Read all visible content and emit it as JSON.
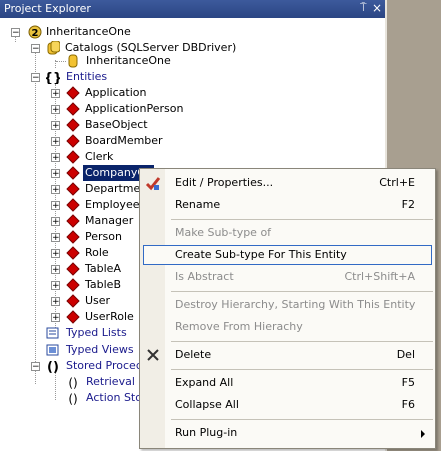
{
  "panel": {
    "title": "Project Explorer",
    "pin_glyph": "⍑",
    "close_glyph": "×"
  },
  "tree": {
    "root": "InheritanceOne",
    "catalogs": "Catalogs (SQLServer DBDriver)",
    "catalog_item": "InheritanceOne",
    "entities_label": "Entities",
    "entities": [
      "Application",
      "ApplicationPerson",
      "BaseObject",
      "BoardMember",
      "Clerk",
      "CompanyCa",
      "Department",
      "Employee",
      "Manager",
      "Person",
      "Role",
      "TableA",
      "TableB",
      "User",
      "UserRole"
    ],
    "typed_lists": "Typed Lists",
    "typed_views": "Typed Views",
    "stored_procedures": "Stored Procedu",
    "retrieval": "Retrieval St",
    "action": "Action Stor"
  },
  "menu": {
    "edit": {
      "label": "Edit / Properties...",
      "shortcut": "Ctrl+E"
    },
    "rename": {
      "label": "Rename",
      "shortcut": "F2"
    },
    "make_subtype": {
      "label": "Make Sub-type of"
    },
    "create_subtype": {
      "label": "Create Sub-type For This Entity"
    },
    "is_abstract": {
      "label": "Is Abstract",
      "shortcut": "Ctrl+Shift+A"
    },
    "destroy": {
      "label": "Destroy Hierarchy, Starting With This Entity"
    },
    "remove": {
      "label": "Remove From Hierachy"
    },
    "delete": {
      "label": "Delete",
      "shortcut": "Del"
    },
    "expand": {
      "label": "Expand All",
      "shortcut": "F5"
    },
    "collapse": {
      "label": "Collapse All",
      "shortcut": "F6"
    },
    "plugin": {
      "label": "Run Plug-in"
    }
  },
  "colors": {
    "entity_red": "#cc0000",
    "selection": "#0a246a",
    "highlight_border": "#316ac5"
  }
}
